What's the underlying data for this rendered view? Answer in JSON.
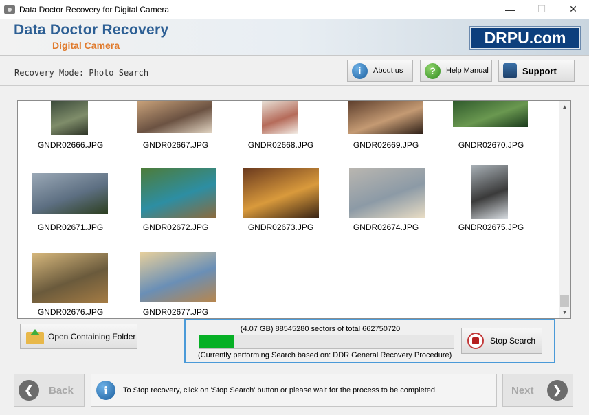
{
  "window": {
    "title": "Data Doctor Recovery for Digital Camera",
    "minimize": "—",
    "maximize": "☐",
    "close": "✕"
  },
  "banner": {
    "title": "Data Doctor Recovery",
    "subtitle": "Digital Camera",
    "logo": "DRPU.com"
  },
  "mode": {
    "text": "Recovery Mode: Photo Search"
  },
  "toolbar": {
    "about": "About us",
    "help": "Help Manual",
    "support": "Support",
    "about_icon": "i",
    "help_icon": "?"
  },
  "thumbnails": [
    {
      "name": "GNDR02666.JPG",
      "colors": [
        "#3b4a3a",
        "#7f8d6a",
        "#2c3326"
      ]
    },
    {
      "name": "GNDR02667.JPG",
      "colors": [
        "#c9a27a",
        "#6b5242",
        "#e3d6c4"
      ]
    },
    {
      "name": "GNDR02668.JPG",
      "colors": [
        "#e8e0d6",
        "#b56b5a",
        "#f4efe8"
      ]
    },
    {
      "name": "GNDR02669.JPG",
      "colors": [
        "#5d3e2c",
        "#c49a73",
        "#2e2018"
      ]
    },
    {
      "name": "GNDR02670.JPG",
      "colors": [
        "#2f5a2c",
        "#6a9850",
        "#1a3a1c"
      ]
    },
    {
      "name": "GNDR02671.JPG",
      "colors": [
        "#9aa8b6",
        "#5d6f82",
        "#2c3e1e"
      ]
    },
    {
      "name": "GNDR02672.JPG",
      "colors": [
        "#4d7c3a",
        "#2d8ea3",
        "#8c6a3c"
      ]
    },
    {
      "name": "GNDR02673.JPG",
      "colors": [
        "#6b3a1e",
        "#d99a3c",
        "#3a2414"
      ]
    },
    {
      "name": "GNDR02674.JPG",
      "colors": [
        "#b9b6b0",
        "#8c9aa6",
        "#e8dcc4"
      ]
    },
    {
      "name": "GNDR02675.JPG",
      "colors": [
        "#a8b0b6",
        "#3a3a3a",
        "#d8dde2"
      ]
    },
    {
      "name": "GNDR02676.JPG",
      "colors": [
        "#d6b77c",
        "#6a5a3c",
        "#a57c44"
      ]
    },
    {
      "name": "GNDR02677.JPG",
      "colors": [
        "#e6cf9c",
        "#6a8fb6",
        "#b8864c"
      ]
    }
  ],
  "scrollbar": {
    "up": "▲",
    "down": "▼"
  },
  "open_folder": {
    "label": "Open Containing Folder"
  },
  "progress": {
    "sectors": "(4.07 GB) 88545280  sectors  of  total 662750720",
    "fraction": 0.134,
    "procedure": "(Currently performing Search based on:  DDR General Recovery Procedure)",
    "stop_label": "Stop Search"
  },
  "footer": {
    "back": "Back",
    "next": "Next",
    "back_icon": "❮",
    "next_icon": "❯",
    "info_icon": "i",
    "message": "To Stop recovery, click on 'Stop Search' button or please wait for the process to be completed."
  }
}
